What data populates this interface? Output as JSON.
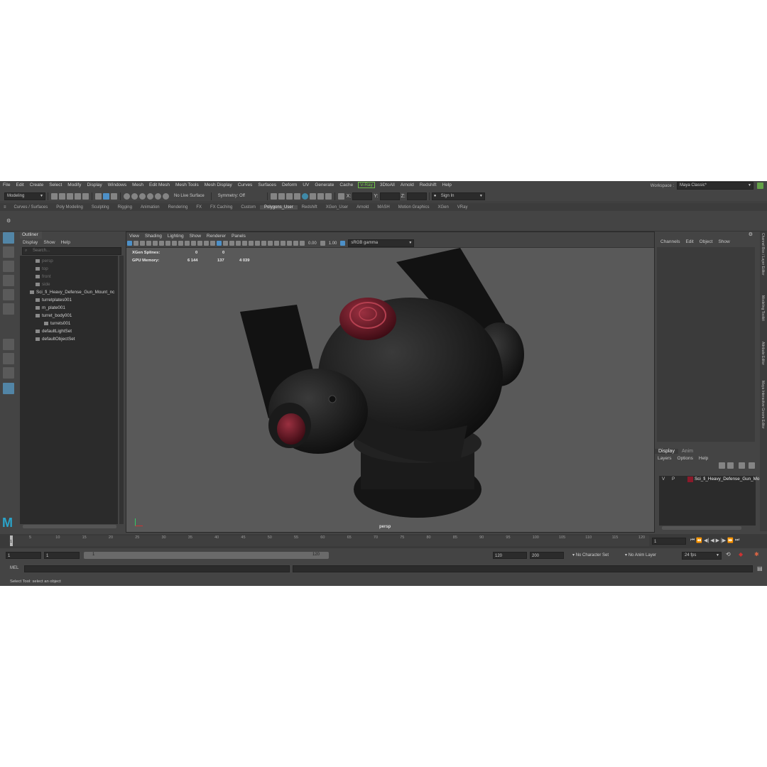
{
  "menu": [
    "File",
    "Edit",
    "Create",
    "Select",
    "Modify",
    "Display",
    "Windows",
    "Mesh",
    "Edit Mesh",
    "Mesh Tools",
    "Mesh Display",
    "Curves",
    "Surfaces",
    "Deform",
    "UV",
    "Generate",
    "Cache",
    "V-Ray",
    "3DtoAll",
    "Arnold",
    "Redshift",
    "Help"
  ],
  "workspace": {
    "label": "Workspace :",
    "value": "Maya Classic*"
  },
  "status": {
    "mode": "Modeling",
    "live_surface": "No Live Surface",
    "symmetry": "Symmetry: Off",
    "x": "X:",
    "y": "Y:",
    "z": "Z:",
    "sign_in": "Sign In"
  },
  "shelf_tabs": [
    "Curves / Surfaces",
    "Poly Modeling",
    "Sculpting",
    "Rigging",
    "Animation",
    "Rendering",
    "FX",
    "FX Caching",
    "Custom",
    "Polygons_User",
    "Redshift",
    "XGen_User",
    "Arnold",
    "MASH",
    "Motion Graphics",
    "XGen",
    "VRay"
  ],
  "shelf_active": "Polygons_User",
  "outliner": {
    "title": "Outliner",
    "menu": [
      "Display",
      "Show",
      "Help"
    ],
    "search_placeholder": "Search...",
    "items": [
      {
        "label": "persp",
        "dim": true
      },
      {
        "label": "top",
        "dim": true
      },
      {
        "label": "front",
        "dim": true
      },
      {
        "label": "side",
        "dim": true
      },
      {
        "label": "Sci_fi_Heavy_Defense_Gun_Mount_nc",
        "dim": false
      },
      {
        "label": "turretplates001",
        "dim": false
      },
      {
        "label": "m_plate001",
        "dim": false
      },
      {
        "label": "turret_body001",
        "dim": false
      },
      {
        "label": "turrets001",
        "dim": false
      },
      {
        "label": "defaultLightSet",
        "dim": false
      },
      {
        "label": "defaultObjectSet",
        "dim": false
      }
    ]
  },
  "viewport": {
    "menu": [
      "View",
      "Shading",
      "Lighting",
      "Show",
      "Renderer",
      "Panels"
    ],
    "exposure": "0.00",
    "gamma": "1.00",
    "colorspace": "sRGB gamma",
    "hud": [
      {
        "label": "XGen Splines:",
        "a": "0",
        "b": "0",
        "c": ""
      },
      {
        "label": "GPU Memory:",
        "a": "6 144",
        "b": "137",
        "c": "4 039"
      }
    ],
    "camera": "persp"
  },
  "channels": {
    "menu": [
      "Channels",
      "Edit",
      "Object",
      "Show"
    ]
  },
  "layers": {
    "tabs": [
      "Display",
      "Anim"
    ],
    "menu": [
      "Layers",
      "Options",
      "Help"
    ],
    "row": {
      "v": "V",
      "p": "P",
      "name": "Sci_fi_Heavy_Defense_Gun_Mo",
      "color": "#8a1a2a"
    }
  },
  "side_tabs": [
    "Channel Box / Layer Editor",
    "Modeling Toolkit",
    "Attribute Editor",
    "Maya Interactive Groom Editor"
  ],
  "timeline": {
    "ticks": [
      "5",
      "10",
      "15",
      "20",
      "25",
      "30",
      "35",
      "40",
      "45",
      "50",
      "55",
      "60",
      "65",
      "70",
      "75",
      "80",
      "85",
      "90",
      "95",
      "100",
      "105",
      "110",
      "115",
      "120"
    ],
    "current": "1",
    "frame_field": "1"
  },
  "range": {
    "start": "1",
    "start2": "1",
    "slider_start": "1",
    "slider_end": "120",
    "end": "120",
    "end2": "200",
    "character": "No Character Set",
    "anim_layer": "No Anim Layer",
    "fps": "24 fps"
  },
  "cmd": {
    "label": "MEL"
  },
  "help": "Select Tool: select an object",
  "colors": {
    "accent": "#5285a6",
    "vray": "#6fc04a",
    "turret_red": "#8a1a2a"
  }
}
